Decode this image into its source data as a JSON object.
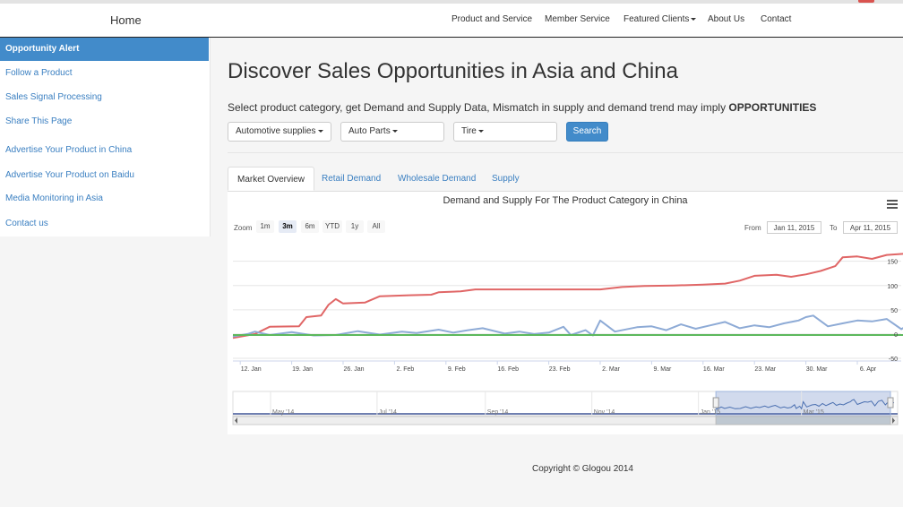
{
  "navbar": {
    "brand": "Home",
    "links": [
      {
        "label": "Product and Service",
        "dropdown": false
      },
      {
        "label": "Member Service",
        "dropdown": false
      },
      {
        "label": "Featured Clients",
        "dropdown": true
      },
      {
        "label": "About Us",
        "dropdown": false
      },
      {
        "label": "Contact",
        "dropdown": false
      }
    ]
  },
  "sidebar": {
    "items": [
      {
        "label": "Opportunity Alert",
        "active": true
      },
      {
        "label": "Follow a Product"
      },
      {
        "label": "Sales Signal Processing"
      },
      {
        "label": "Share This Page"
      },
      {
        "label": "Advertise Your Product in China"
      },
      {
        "label": "Advertise Your Product on Baidu"
      },
      {
        "label": "Media Monitoring in Asia"
      },
      {
        "label": "Contact us"
      }
    ]
  },
  "main": {
    "title": "Discover Sales Opportunities in Asia and China",
    "subtitle_prefix": "Select product category, get Demand and Supply Data, Mismatch in supply and demand trend may imply",
    "subtitle_emphasis": "OPPORTUNITIES",
    "filters": {
      "category": "Automotive supplies",
      "subcategory": "Auto Parts",
      "product": "Tire"
    },
    "search_label": "Search",
    "tabs": [
      "Market Overview",
      "Retail Demand",
      "Wholesale Demand",
      "Supply"
    ],
    "active_tab": "Market Overview"
  },
  "chart_data": {
    "type": "line",
    "title": "Demand and Supply For The Product Category in China",
    "range_selector": {
      "zoom_label": "Zoom",
      "buttons": [
        "1m",
        "3m",
        "6m",
        "YTD",
        "1y",
        "All"
      ],
      "selected": "3m",
      "from_label": "From",
      "from": "Jan 11, 2015",
      "to_label": "To",
      "to": "Apr 11, 2015"
    },
    "x_start": "2015-01-11",
    "x_end": "2015-04-11",
    "x_tick_labels": [
      "12. Jan",
      "19. Jan",
      "26. Jan",
      "2. Feb",
      "9. Feb",
      "16. Feb",
      "23. Feb",
      "2. Mar",
      "9. Mar",
      "16. Mar",
      "23. Mar",
      "30. Mar",
      "6. Apr"
    ],
    "y_ticks": [
      150,
      100,
      50,
      0,
      -50
    ],
    "ylim": [
      -50,
      190
    ],
    "grid": true,
    "series": [
      {
        "color": "#e06666",
        "points": [
          [
            "2015-01-11",
            -8
          ],
          [
            "2015-01-14",
            0
          ],
          [
            "2015-01-16",
            15
          ],
          [
            "2015-01-20",
            16
          ],
          [
            "2015-01-21",
            35
          ],
          [
            "2015-01-23",
            38
          ],
          [
            "2015-01-24",
            60
          ],
          [
            "2015-01-25",
            72
          ],
          [
            "2015-01-26",
            63
          ],
          [
            "2015-01-29",
            65
          ],
          [
            "2015-01-31",
            78
          ],
          [
            "2015-02-04",
            80
          ],
          [
            "2015-02-07",
            81
          ],
          [
            "2015-02-08",
            86
          ],
          [
            "2015-02-11",
            88
          ],
          [
            "2015-02-13",
            92
          ],
          [
            "2015-03-02",
            92
          ],
          [
            "2015-03-05",
            97
          ],
          [
            "2015-03-08",
            99
          ],
          [
            "2015-03-12",
            100
          ],
          [
            "2015-03-16",
            102
          ],
          [
            "2015-03-19",
            104
          ],
          [
            "2015-03-21",
            110
          ],
          [
            "2015-03-23",
            120
          ],
          [
            "2015-03-26",
            122
          ],
          [
            "2015-03-28",
            118
          ],
          [
            "2015-03-30",
            123
          ],
          [
            "2015-04-01",
            130
          ],
          [
            "2015-04-03",
            140
          ],
          [
            "2015-04-04",
            158
          ],
          [
            "2015-04-06",
            160
          ],
          [
            "2015-04-08",
            155
          ],
          [
            "2015-04-10",
            163
          ],
          [
            "2015-04-15",
            168
          ],
          [
            "2015-04-18",
            170
          ],
          [
            "2015-04-21",
            173
          ],
          [
            "2015-04-23",
            175
          ]
        ]
      },
      {
        "color": "#8eabd6",
        "points": [
          [
            "2015-01-11",
            -5
          ],
          [
            "2015-01-13",
            0
          ],
          [
            "2015-01-14",
            5
          ],
          [
            "2015-01-16",
            -2
          ],
          [
            "2015-01-19",
            4
          ],
          [
            "2015-01-22",
            -3
          ],
          [
            "2015-01-25",
            -2
          ],
          [
            "2015-01-28",
            6
          ],
          [
            "2015-01-31",
            -1
          ],
          [
            "2015-02-03",
            5
          ],
          [
            "2015-02-05",
            2
          ],
          [
            "2015-02-08",
            9
          ],
          [
            "2015-02-10",
            3
          ],
          [
            "2015-02-12",
            8
          ],
          [
            "2015-02-14",
            12
          ],
          [
            "2015-02-17",
            1
          ],
          [
            "2015-02-19",
            5
          ],
          [
            "2015-02-21",
            0
          ],
          [
            "2015-02-23",
            3
          ],
          [
            "2015-02-25",
            15
          ],
          [
            "2015-02-26",
            -2
          ],
          [
            "2015-02-28",
            8
          ],
          [
            "2015-03-01",
            -3
          ],
          [
            "2015-03-02",
            28
          ],
          [
            "2015-03-04",
            5
          ],
          [
            "2015-03-07",
            14
          ],
          [
            "2015-03-09",
            16
          ],
          [
            "2015-03-11",
            8
          ],
          [
            "2015-03-13",
            20
          ],
          [
            "2015-03-15",
            11
          ],
          [
            "2015-03-17",
            18
          ],
          [
            "2015-03-19",
            25
          ],
          [
            "2015-03-21",
            12
          ],
          [
            "2015-03-23",
            18
          ],
          [
            "2015-03-25",
            14
          ],
          [
            "2015-03-27",
            22
          ],
          [
            "2015-03-29",
            28
          ],
          [
            "2015-03-30",
            35
          ],
          [
            "2015-03-31",
            38
          ],
          [
            "2015-04-02",
            16
          ],
          [
            "2015-04-04",
            22
          ],
          [
            "2015-04-06",
            28
          ],
          [
            "2015-04-08",
            26
          ],
          [
            "2015-04-10",
            31
          ],
          [
            "2015-04-12",
            10
          ],
          [
            "2015-04-14",
            30
          ],
          [
            "2015-04-16",
            35
          ],
          [
            "2015-04-18",
            14
          ],
          [
            "2015-04-20",
            30
          ],
          [
            "2015-04-22",
            22
          ],
          [
            "2015-04-23",
            24
          ]
        ]
      },
      {
        "color": "#5cb85c",
        "points": [
          [
            "2015-01-11",
            -2
          ],
          [
            "2015-04-23",
            -2
          ]
        ]
      }
    ],
    "navigator": {
      "labels": [
        "May '14",
        "Jul '14",
        "Sep '14",
        "Nov '14",
        "Jan '15",
        "Mar '15"
      ]
    }
  },
  "footer": {
    "copyright": "Copyright © Glogou 2014"
  }
}
